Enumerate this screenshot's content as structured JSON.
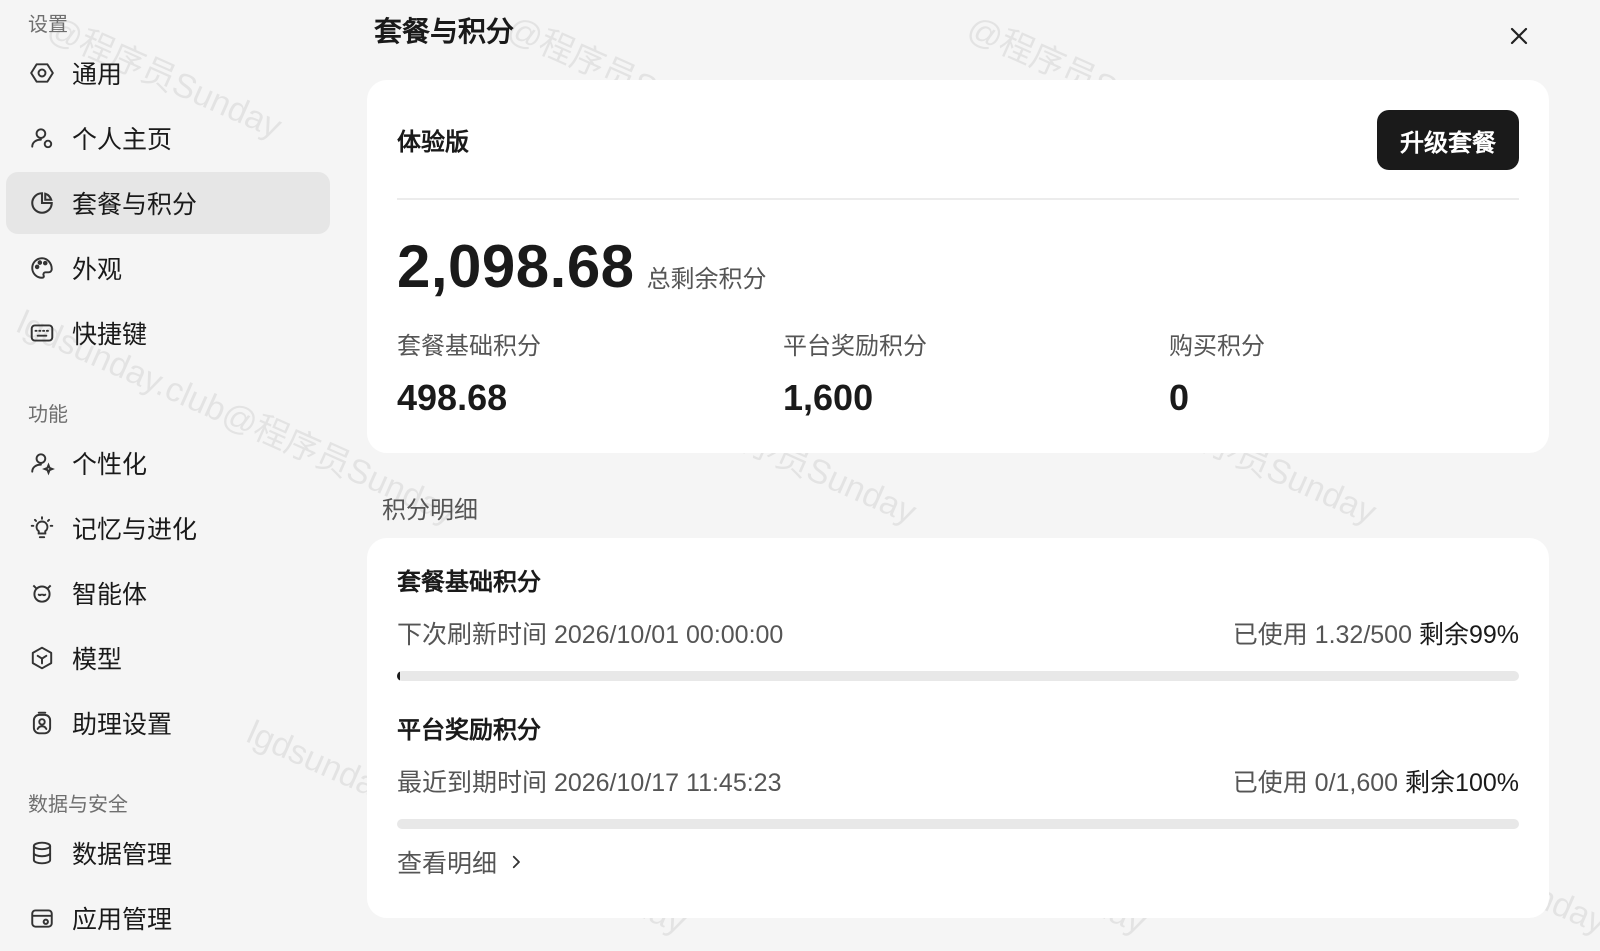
{
  "sidebar": {
    "sections": [
      {
        "label": "设置",
        "items": [
          {
            "label": "通用",
            "icon": "gear-icon"
          },
          {
            "label": "个人主页",
            "icon": "user-icon"
          },
          {
            "label": "套餐与积分",
            "icon": "pie-chart-icon",
            "active": true
          },
          {
            "label": "外观",
            "icon": "palette-icon"
          },
          {
            "label": "快捷键",
            "icon": "keyboard-icon"
          }
        ]
      },
      {
        "label": "功能",
        "items": [
          {
            "label": "个性化",
            "icon": "user-sparkle-icon"
          },
          {
            "label": "记忆与进化",
            "icon": "lightbulb-icon"
          },
          {
            "label": "智能体",
            "icon": "agent-icon"
          },
          {
            "label": "模型",
            "icon": "cube-icon"
          },
          {
            "label": "助理设置",
            "icon": "assistant-icon"
          }
        ]
      },
      {
        "label": "数据与安全",
        "items": [
          {
            "label": "数据管理",
            "icon": "database-icon"
          },
          {
            "label": "应用管理",
            "icon": "app-icon"
          }
        ]
      }
    ]
  },
  "main": {
    "title": "套餐与积分",
    "plan": {
      "name": "体验版",
      "upgrade_label": "升级套餐",
      "total_value": "2,098.68",
      "total_label": "总剩余积分",
      "breakdown": [
        {
          "label": "套餐基础积分",
          "value": "498.68"
        },
        {
          "label": "平台奖励积分",
          "value": "1,600"
        },
        {
          "label": "购买积分",
          "value": "0"
        }
      ]
    },
    "detail_title": "积分明细",
    "details": [
      {
        "title": "套餐基础积分",
        "left": "下次刷新时间 2026/10/01 00:00:00",
        "used_label": "已使用 1.32/500",
        "remain_label": "剩余99%",
        "used_fraction": 0.0026
      },
      {
        "title": "平台奖励积分",
        "left": "最近到期时间 2026/10/17 11:45:23",
        "used_label": "已使用 0/1,600",
        "remain_label": "剩余100%",
        "used_fraction": 0
      }
    ],
    "view_detail_label": "查看明细"
  },
  "watermark_text_1": "lgdsunday.club@程序员Sunday",
  "watermark_text_2": "@程序员Sunday"
}
